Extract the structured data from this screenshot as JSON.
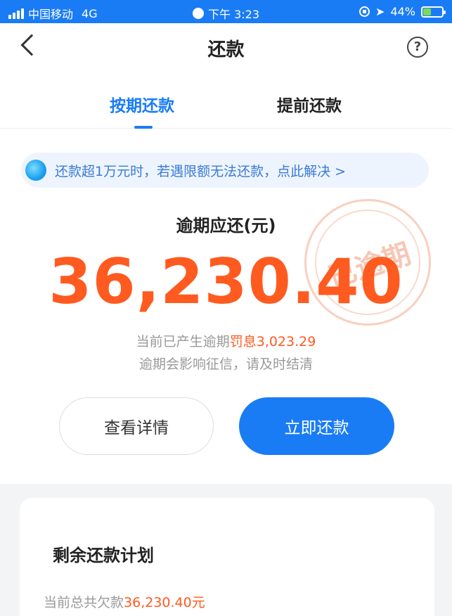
{
  "status_bar": {
    "carrier": "中国移动",
    "network": "4G",
    "time": "下午 3:23",
    "battery": "44%",
    "battery_level": 0.44
  },
  "nav": {
    "title": "还款",
    "help_symbol": "?"
  },
  "tabs": [
    {
      "label": "按期还款",
      "active": true
    },
    {
      "label": "提前还款",
      "active": false
    }
  ],
  "notice": {
    "text": "还款超1万元时，若遇限额无法还款，点此解决 >"
  },
  "overdue": {
    "label": "逾期应还(元)",
    "amount": "36,230.40",
    "penalty_prefix": "当前已产生逾期",
    "penalty_value": "罚息3,023.29",
    "warning": "逾期会影响征信，请及时结清"
  },
  "stamp": {
    "text": "已逾期"
  },
  "buttons": {
    "detail": "查看详情",
    "pay": "立即还款"
  },
  "plan": {
    "title": "剩余还款计划",
    "debt_prefix": "当前总共欠款",
    "debt_value": "36,230.40元"
  },
  "colors": {
    "brand_blue": "#1a7cf5",
    "accent_orange": "#ff5a1f"
  },
  "icons": [
    "back-icon",
    "help-icon",
    "signal-icon",
    "location-icon",
    "battery-icon",
    "notice-icon"
  ]
}
